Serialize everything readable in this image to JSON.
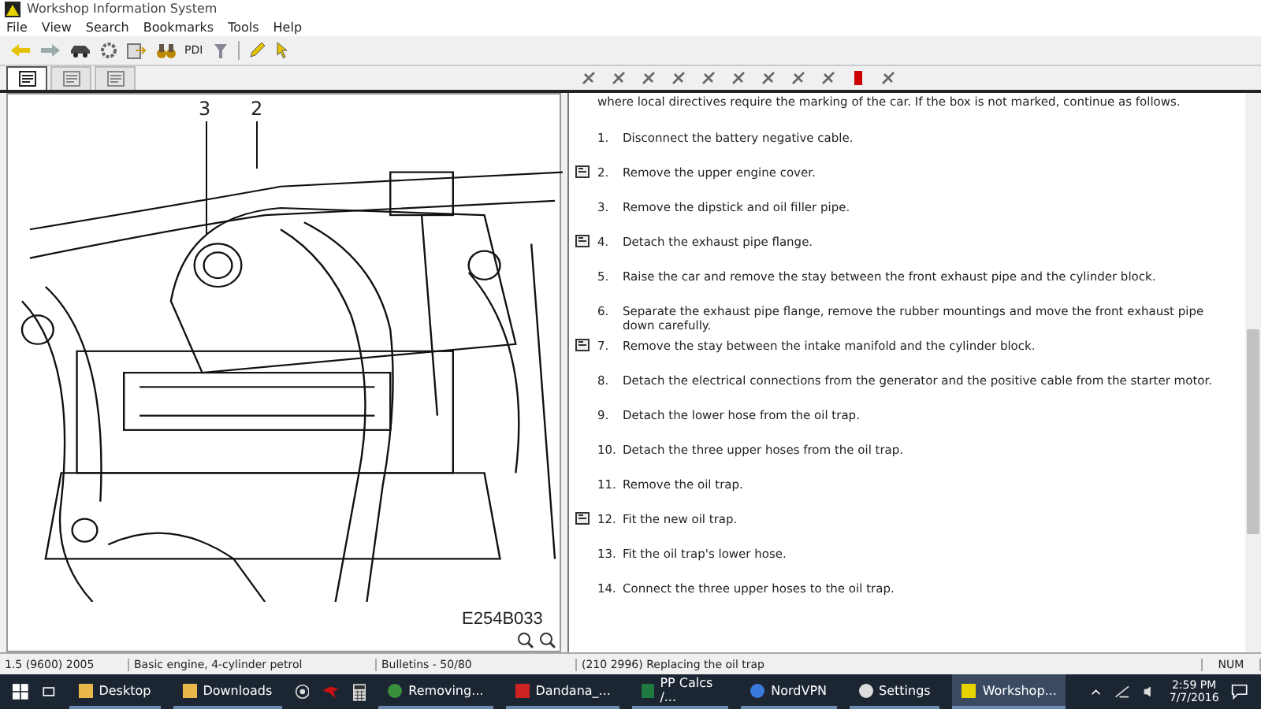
{
  "window": {
    "title": "Workshop Information System"
  },
  "menu": [
    "File",
    "View",
    "Search",
    "Bookmarks",
    "Tools",
    "Help"
  ],
  "toolbar": {
    "pdi_label": "PDI"
  },
  "tabs": [
    {
      "selected": true
    },
    {
      "selected": false
    },
    {
      "selected": false
    }
  ],
  "figure": {
    "callouts": [
      "3",
      "2"
    ],
    "code": "E254B033"
  },
  "document": {
    "intro": "where local directives require the marking of the car. If the box is not marked, continue as follows.",
    "steps": [
      {
        "num": "1.",
        "text": "Disconnect the battery negative cable.",
        "marker": false
      },
      {
        "num": "2.",
        "text": "Remove the upper engine cover.",
        "marker": true
      },
      {
        "num": "3.",
        "text": "Remove the dipstick and oil filler pipe.",
        "marker": false
      },
      {
        "num": "4.",
        "text": "Detach the exhaust pipe flange.",
        "marker": true
      },
      {
        "num": "5.",
        "text": "Raise the car and remove the stay between the front exhaust pipe and the cylinder block.",
        "marker": false
      },
      {
        "num": "6.",
        "text": "Separate the exhaust pipe flange, remove the rubber mountings and move the front exhaust pipe down carefully.",
        "marker": false
      },
      {
        "num": "7.",
        "text": "Remove the stay between the intake manifold and the cylinder block.",
        "marker": true
      },
      {
        "num": "8.",
        "text": "Detach the electrical connections from the generator and the positive cable from the starter motor.",
        "marker": false
      },
      {
        "num": "9.",
        "text": "Detach the lower hose from the oil trap.",
        "marker": false
      },
      {
        "num": "10.",
        "text": "Detach the three upper hoses from the oil trap.",
        "marker": false
      },
      {
        "num": "11.",
        "text": "Remove the oil trap.",
        "marker": false
      },
      {
        "num": "12.",
        "text": "Fit the new oil trap.",
        "marker": true
      },
      {
        "num": "13.",
        "text": "Fit the oil trap's lower hose.",
        "marker": false
      },
      {
        "num": "14.",
        "text": "Connect the three upper hoses to the oil trap.",
        "marker": false
      }
    ]
  },
  "status_bar": [
    "1.5 (9600) 2005",
    "Basic engine, 4-cylinder petrol",
    "Bulletins - 50/80",
    "(210 2996) Replacing the oil trap",
    "NUM"
  ],
  "taskbar": {
    "apps": [
      {
        "label": "Desktop",
        "kind": "folder",
        "selected": false
      },
      {
        "label": "Downloads",
        "kind": "folder",
        "selected": false
      },
      {
        "label": "Removing...",
        "kind": "browser",
        "selected": false
      },
      {
        "label": "Dandana_...",
        "kind": "pdf",
        "selected": false
      },
      {
        "label": "PP Calcs /...",
        "kind": "sheet",
        "selected": false
      },
      {
        "label": "NordVPN",
        "kind": "vpn",
        "selected": false
      },
      {
        "label": "Settings",
        "kind": "gear",
        "selected": false
      },
      {
        "label": "Workshop...",
        "kind": "app",
        "selected": true
      }
    ],
    "time": "2:59 PM",
    "date": "7/7/2016"
  }
}
